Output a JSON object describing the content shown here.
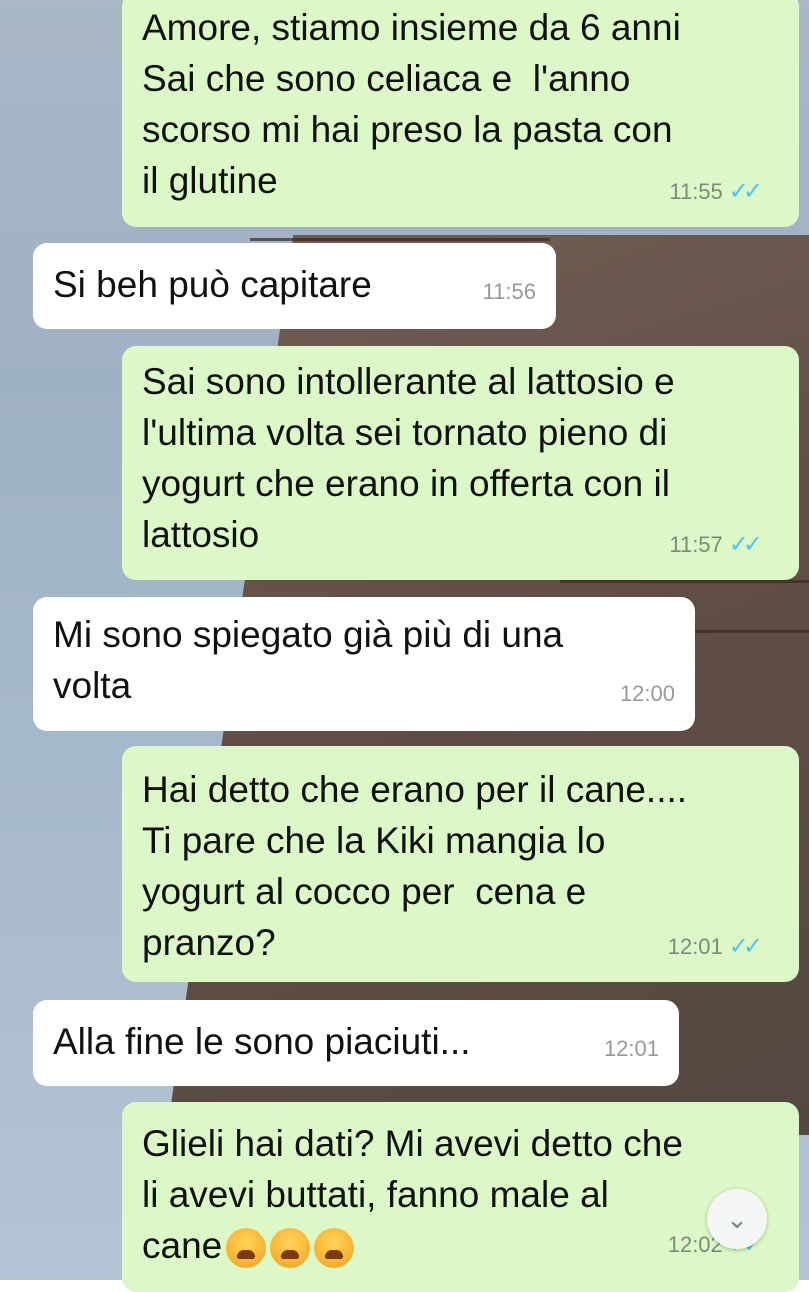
{
  "messages": [
    {
      "dir": "out",
      "text": "Amore, stiamo insieme da 6 anni\nSai che sono celiaca e  l'anno\nscorso mi hai preso la pasta con\nil glutine",
      "time": "11:55",
      "read": true
    },
    {
      "dir": "in",
      "text": "Si beh può capitare",
      "time": "11:56"
    },
    {
      "dir": "out",
      "text": "Sai sono intollerante al lattosio e\nl'ultima volta sei tornato pieno di\nyogurt che erano in offerta con il\nlattosio",
      "time": "11:57",
      "read": true
    },
    {
      "dir": "in",
      "text": "Mi sono spiegato già più di una\nvolta",
      "time": "12:00"
    },
    {
      "dir": "out",
      "text": "Hai detto che erano per il cane....\nTi pare che la Kiki mangia lo\nyogurt al cocco per  cena e\npranzo?",
      "time": "12:01",
      "read": true
    },
    {
      "dir": "in",
      "text": "Alla fine le sono piaciuti...",
      "time": "12:01"
    },
    {
      "dir": "out",
      "text": "Glieli hai dati? Mi avevi detto che\nli avevi buttati, fanno male al\ncane",
      "emoji": [
        "weary-face",
        "weary-face",
        "weary-face"
      ],
      "time": "12:02",
      "read": true
    }
  ],
  "icons": {
    "read_ticks": "✓✓",
    "scroll_down": "⌄"
  },
  "colors": {
    "outgoing_bubble": "#dcf8c6",
    "incoming_bubble": "#ffffff",
    "read_ticks": "#4fc3f7"
  }
}
